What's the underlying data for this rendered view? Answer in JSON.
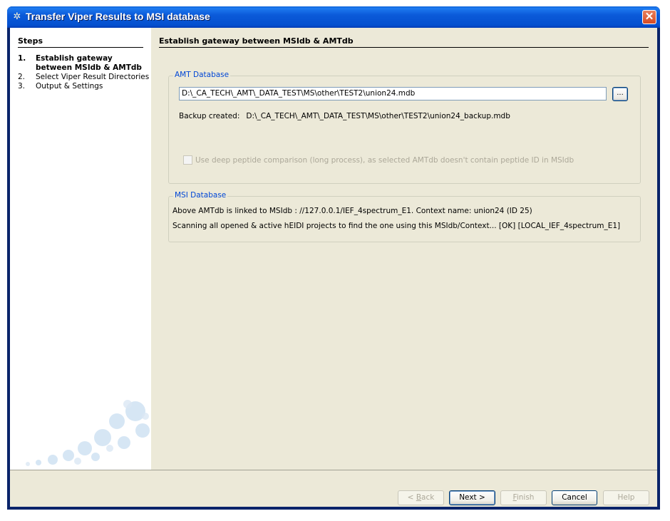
{
  "window": {
    "title": "Transfer Viper Results to MSI database",
    "close_glyph": "✕"
  },
  "steps": {
    "title": "Steps",
    "items": [
      {
        "num": "1.",
        "label": "Establish gateway between MSIdb & AMTdb",
        "active": true
      },
      {
        "num": "2.",
        "label": "Select Viper Result Directories",
        "active": false
      },
      {
        "num": "3.",
        "label": "Output & Settings",
        "active": false
      }
    ]
  },
  "page": {
    "title": "Establish gateway between MSIdb & AMTdb",
    "amt": {
      "legend": "AMT Database",
      "path_value": "D:\\_CA_TECH\\_AMT\\_DATA_TEST\\MS\\other\\TEST2\\union24.mdb",
      "browse_label": "...",
      "backup_label": "Backup created:",
      "backup_path": "D:\\_CA_TECH\\_AMT\\_DATA_TEST\\MS\\other\\TEST2\\union24_backup.mdb",
      "deep_compare_label": "Use deep peptide comparison (long process), as selected AMTdb doesn't contain peptide ID in MSIdb",
      "deep_compare_checked": false
    },
    "msi": {
      "legend": "MSI Database",
      "line1": "Above AMTdb is linked to MSIdb :   //127.0.0.1/IEF_4spectrum_E1. Context name: union24 (ID 25)",
      "line2": "Scanning all opened & active hEIDI projects to find the one using this MSIdb/Context...  [OK] [LOCAL_IEF_4spectrum_E1]"
    }
  },
  "buttons": {
    "back": {
      "prefix": "< ",
      "mnemonic": "B",
      "rest": "ack"
    },
    "next": "Next >",
    "finish": {
      "mnemonic": "F",
      "rest": "inish"
    },
    "cancel": "Cancel",
    "help": "Help"
  },
  "colors": {
    "title_bar": "#0450cf",
    "legend_blue": "#0046d5",
    "dialog_bg": "#ece9d8"
  }
}
